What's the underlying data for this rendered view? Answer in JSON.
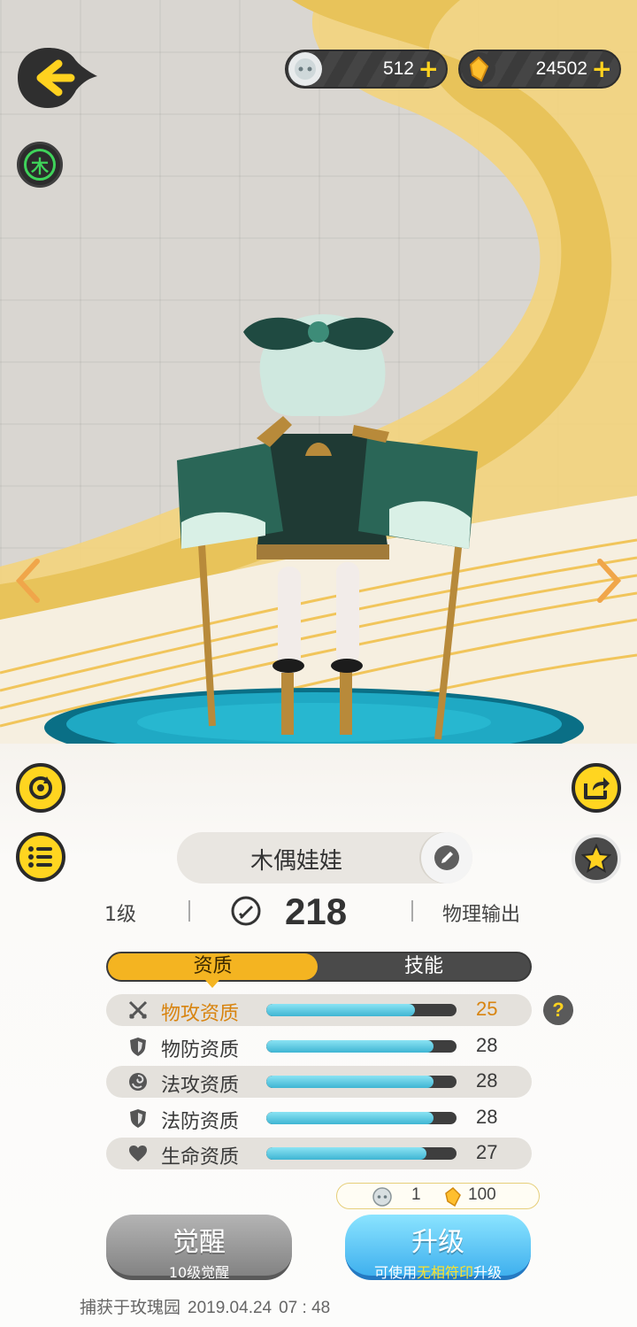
{
  "currencies": [
    {
      "icon": "soul-stone-icon",
      "value": "512",
      "plus": "+"
    },
    {
      "icon": "gold-crystal-icon",
      "value": "24502",
      "plus": "+"
    }
  ],
  "element": {
    "label": "木",
    "color": "#3fd35a"
  },
  "pet": {
    "name": "木偶娃娃",
    "level": "1级",
    "power": "218",
    "role": "物理输出"
  },
  "tabs": {
    "active": "资质",
    "inactive": "技能"
  },
  "attributes": [
    {
      "label": "物攻资质",
      "value": "25",
      "fill": 0.78,
      "highlight": true,
      "icon": "crossed-swords-icon"
    },
    {
      "label": "物防资质",
      "value": "28",
      "fill": 0.88,
      "highlight": false,
      "icon": "shield-icon"
    },
    {
      "label": "法攻资质",
      "value": "28",
      "fill": 0.88,
      "highlight": false,
      "icon": "magic-swirl-icon"
    },
    {
      "label": "法防资质",
      "value": "28",
      "fill": 0.88,
      "highlight": false,
      "icon": "shield-icon"
    },
    {
      "label": "生命资质",
      "value": "27",
      "fill": 0.84,
      "highlight": false,
      "icon": "heart-icon"
    }
  ],
  "help": "?",
  "cost": {
    "soul_count": "1",
    "crystal_count": "100"
  },
  "buttons": {
    "awaken_title": "觉醒",
    "awaken_sub": "10级觉醒",
    "upgrade_title": "升级",
    "upgrade_sub_pre": "可使用",
    "upgrade_sub_hl": "无相符印",
    "upgrade_sub_post": "升级"
  },
  "capture": {
    "text": "捕获于玫瑰园",
    "date": "2019.04.24",
    "time": "07 : 48"
  },
  "colors": {
    "accent": "#f4b421",
    "highlight": "#d88410",
    "bar": "#3fb5d3"
  }
}
